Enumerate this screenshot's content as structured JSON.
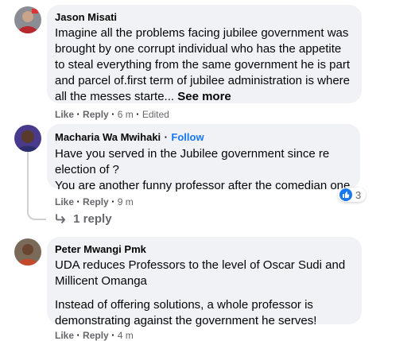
{
  "comments": [
    {
      "author": "Jason Misati",
      "lines": [
        "Imagine all the problems facing jubilee government was",
        "brought by one corrupt individual who has the appetite",
        "to steal everything from the same government he is part",
        "and parcel of.first term of jubilee administration is where",
        "all the messes starte..."
      ],
      "see_more": "See more",
      "like": "Like",
      "reply": "Reply",
      "time": "6 m",
      "edited": "Edited"
    },
    {
      "author": "Macharia Wa Mwihaki",
      "follow": "Follow",
      "lines": [
        "Have you served in the Jubilee government since re",
        "election of ?",
        "You are another funny professor after the comedian one"
      ],
      "like": "Like",
      "reply": "Reply",
      "time": "9 m",
      "reaction_count": "3",
      "reply_count": "1 reply"
    },
    {
      "author": "Peter Mwangi Pmk",
      "lines": [
        "UDA reduces Professors to the level of Oscar Sudi and",
        "Millicent Omanga"
      ],
      "lines2": [
        "Instead of offering solutions, a whole professor is",
        "demonstrating against the government he serves!"
      ],
      "like": "Like",
      "reply": "Reply",
      "time": "4 m"
    }
  ],
  "sep": "·",
  "icons": {
    "reaction": "like-icon",
    "reply_arrow": "reply-arrow-icon"
  },
  "colors": {
    "bubble": "#f0f2f5",
    "link": "#1877f2",
    "meta": "#65676b"
  }
}
